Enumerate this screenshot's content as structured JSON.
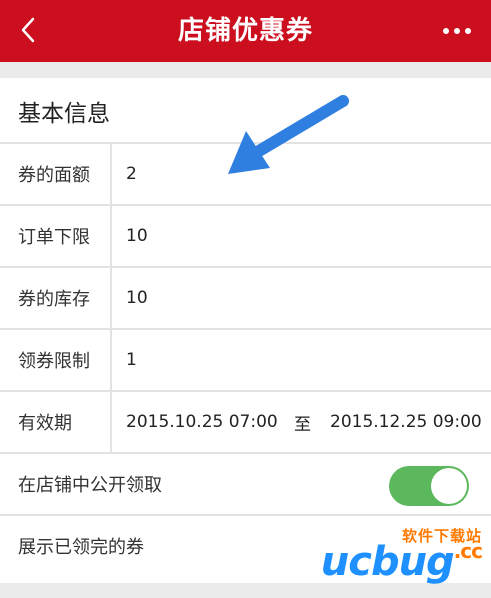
{
  "header": {
    "title": "店铺优惠券"
  },
  "section": {
    "title": "基本信息"
  },
  "fields": [
    {
      "label": "券的面额",
      "value": "2"
    },
    {
      "label": "订单下限",
      "value": "10"
    },
    {
      "label": "券的库存",
      "value": "10"
    },
    {
      "label": "领券限制",
      "value": "1"
    }
  ],
  "validity": {
    "label": "有效期",
    "start": "2015.10.25 07:00",
    "separator": "至",
    "end": "2015.12.25 09:00"
  },
  "public_claim": {
    "label": "在店铺中公开领取",
    "enabled": true
  },
  "show_claimed": {
    "label": "展示已领完的券"
  },
  "watermark": {
    "site_name": "软件下载站",
    "logo_text": "ucbug",
    "logo_suffix": ".cc"
  },
  "colors": {
    "header": "#cc0f1e",
    "toggle_on": "#5cb85c",
    "arrow": "#2f7fe0"
  },
  "icons": [
    "back-arrow-icon",
    "more-dots-icon",
    "pointer-arrow-icon"
  ]
}
